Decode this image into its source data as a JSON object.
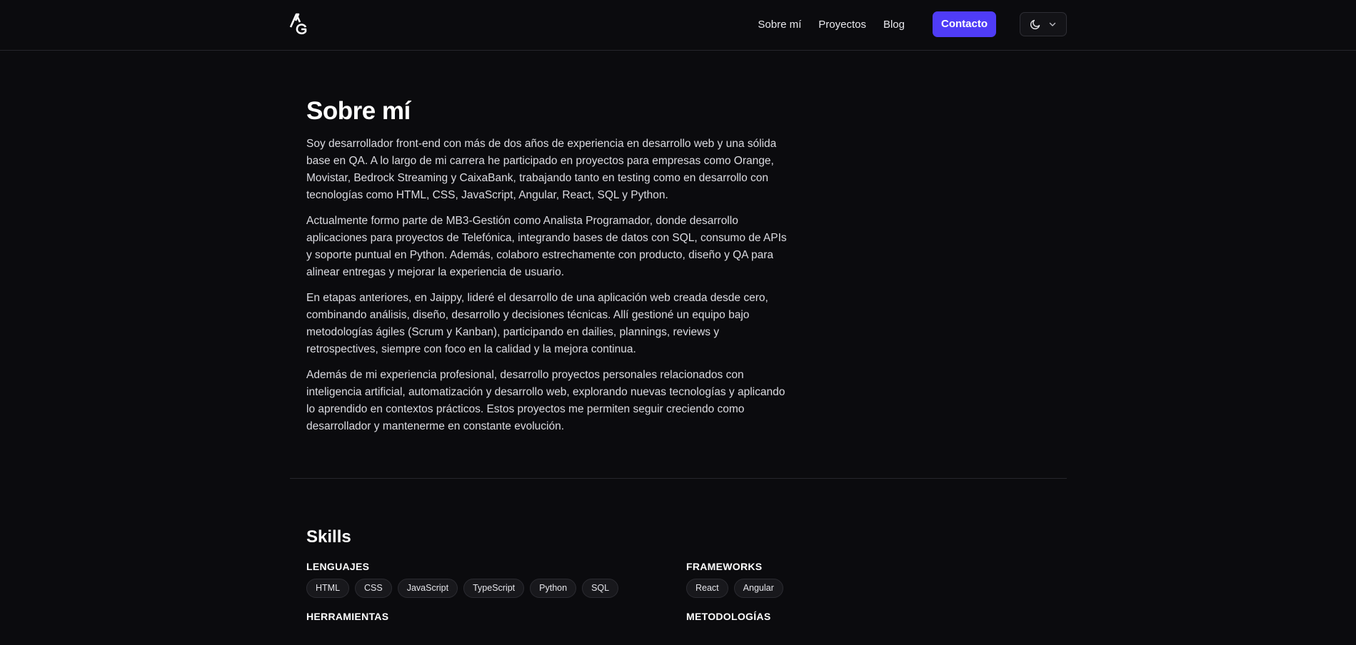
{
  "header": {
    "logo_text": "AG",
    "nav": [
      "Sobre mí",
      "Proyectos",
      "Blog"
    ],
    "contact_label": "Contacto",
    "theme_icon": "moon-icon",
    "theme_chevron_icon": "chevron-down-icon"
  },
  "about": {
    "title": "Sobre mí",
    "paragraphs": [
      "Soy desarrollador front-end con más de dos años de experiencia en desarrollo web y una sólida base en QA. A lo largo de mi carrera he participado en proyectos para empresas como Orange, Movistar, Bedrock Streaming y CaixaBank, trabajando tanto en testing como en desarrollo con tecnologías como HTML, CSS, JavaScript, Angular, React, SQL y Python.",
      "Actualmente formo parte de MB3-Gestión como Analista Programador, donde desarrollo aplicaciones para proyectos de Telefónica, integrando bases de datos con SQL, consumo de APIs y soporte puntual en Python. Además, colaboro estrechamente con producto, diseño y QA para alinear entregas y mejorar la experiencia de usuario.",
      "En etapas anteriores, en Jaippy, lideré el desarrollo de una aplicación web creada desde cero, combinando análisis, diseño, desarrollo y decisiones técnicas. Allí gestioné un equipo bajo metodologías ágiles (Scrum y Kanban), participando en dailies, plannings, reviews y retrospectives, siempre con foco en la calidad y la mejora continua.",
      "Además de mi experiencia profesional, desarrollo proyectos personales relacionados con inteligencia artificial, automatización y desarrollo web, explorando nuevas tecnologías y aplicando lo aprendido en contextos prácticos. Estos proyectos me permiten seguir creciendo como desarrollador y mantenerme en constante evolución."
    ]
  },
  "skills": {
    "title": "Skills",
    "groups": [
      {
        "title": "LENGUAJES",
        "items": [
          "HTML",
          "CSS",
          "JavaScript",
          "TypeScript",
          "Python",
          "SQL"
        ]
      },
      {
        "title": "FRAMEWORKS",
        "items": [
          "React",
          "Angular"
        ]
      },
      {
        "title": "HERRAMIENTAS",
        "items": []
      },
      {
        "title": "METODOLOGÍAS",
        "items": []
      }
    ]
  },
  "colors": {
    "background": "#0b0b0e",
    "accent": "#4f3cf7",
    "chip_bg": "#18181c"
  }
}
